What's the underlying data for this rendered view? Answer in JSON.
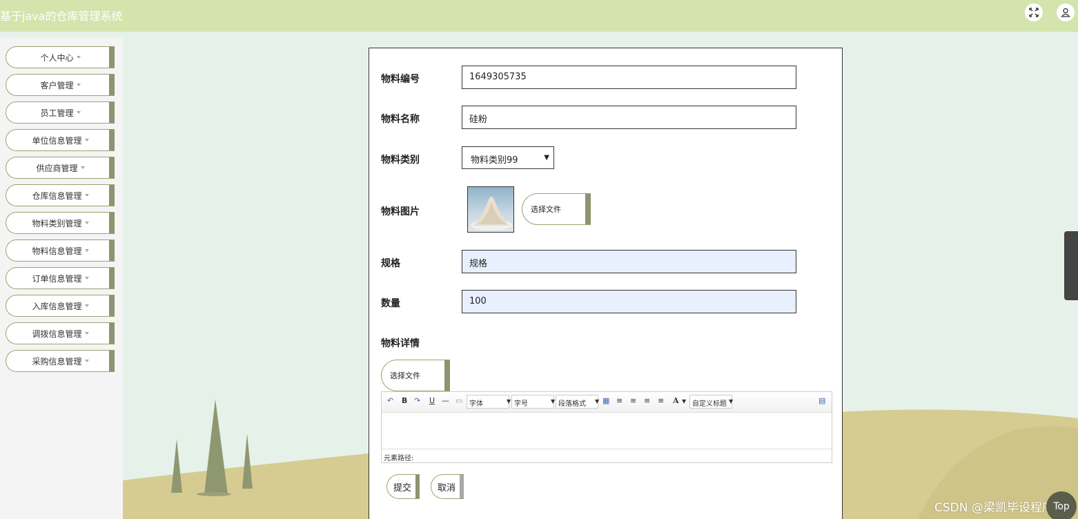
{
  "app": {
    "title": "基于java的仓库管理系统"
  },
  "header": {
    "fullscreen_icon": "expand-icon",
    "user_icon": "user-icon"
  },
  "sidebar": {
    "items": [
      {
        "label": "个人中心"
      },
      {
        "label": "客户管理"
      },
      {
        "label": "员工管理"
      },
      {
        "label": "单位信息管理"
      },
      {
        "label": "供应商管理"
      },
      {
        "label": "仓库信息管理"
      },
      {
        "label": "物料类别管理"
      },
      {
        "label": "物料信息管理"
      },
      {
        "label": "订单信息管理"
      },
      {
        "label": "入库信息管理"
      },
      {
        "label": "调拨信息管理"
      },
      {
        "label": "采购信息管理"
      }
    ]
  },
  "form": {
    "code": {
      "label": "物料编号",
      "value": "1649305735"
    },
    "name": {
      "label": "物料名称",
      "value": "硅粉"
    },
    "category": {
      "label": "物料类别",
      "value": "物料类别99"
    },
    "image": {
      "label": "物料图片",
      "button": "选择文件"
    },
    "spec": {
      "label": "规格",
      "value": "规格"
    },
    "quantity": {
      "label": "数量",
      "value": "100"
    },
    "detail": {
      "label": "物料详情",
      "button": "选择文件"
    }
  },
  "editor": {
    "font_label": "字体",
    "size_label": "字号",
    "paragraph_label": "段落格式",
    "custom_title_label": "自定义标题",
    "bold": "B",
    "underline": "U",
    "font_color": "A",
    "status": "元素路径:"
  },
  "actions": {
    "submit": "提交",
    "cancel": "取消"
  },
  "watermark": "CSDN @梁凯毕设程序",
  "top_button": "Top",
  "colors": {
    "header": "#d4e4ad",
    "accent": "#8d9470",
    "background": "#e6f1ea"
  }
}
